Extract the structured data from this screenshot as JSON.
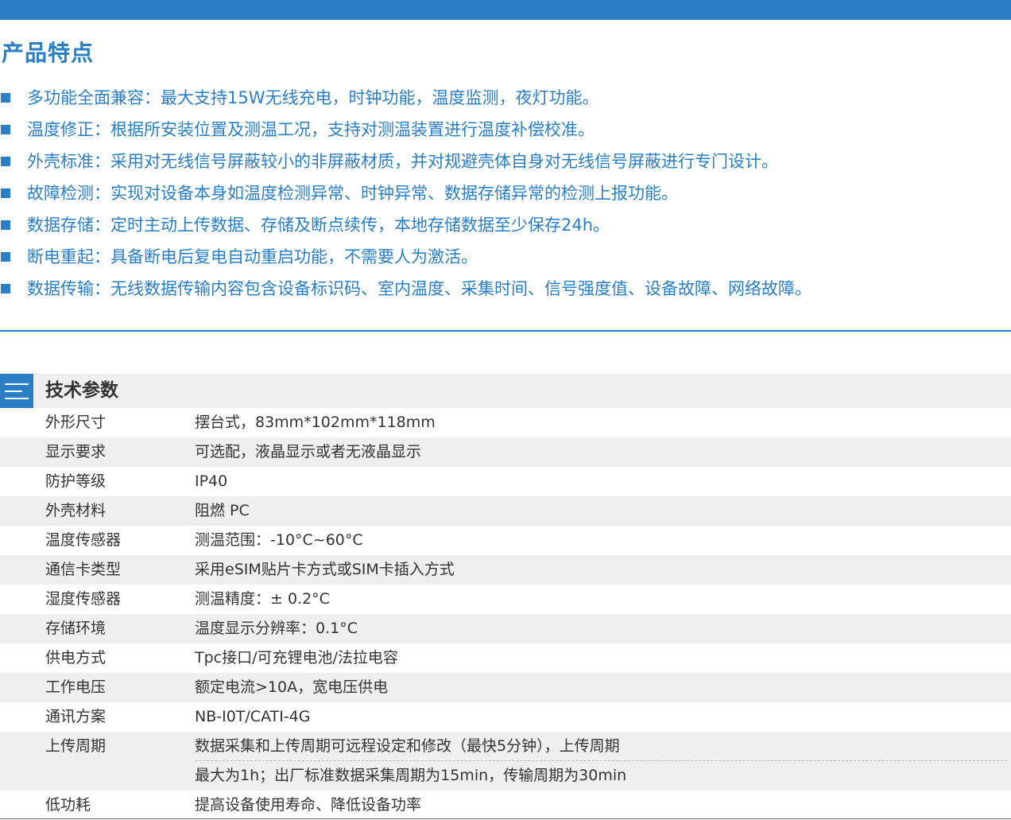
{
  "features": {
    "title": "产品特点",
    "items": [
      "多功能全面兼容：最大支持15W无线充电，时钟功能，温度监测，夜灯功能。",
      "温度修正：根据所安装位置及测温工况，支持对测温装置进行温度补偿校准。",
      "外壳标准：采用对无线信号屏蔽较小的非屏蔽材质，并对规避壳体自身对无线信号屏蔽进行专门设计。",
      "故障检测：实现对设备本身如温度检测异常、时钟异常、数据存储异常的检测上报功能。",
      "数据存储：定时主动上传数据、存储及断点续传，本地存储数据至少保存24h。",
      "断电重起：具备断电后复电自动重启功能，不需要人为激活。",
      "数据传输：无线数据传输内容包含设备标识码、室内温度、采集时间、信号强度值、设备故障、网络故障。"
    ]
  },
  "specs": {
    "title": "技术参数",
    "rows": [
      {
        "label": "外形尺寸",
        "value": "摆台式，83mm*102mm*118mm"
      },
      {
        "label": "显示要求",
        "value": "可选配，液晶显示或者无液晶显示"
      },
      {
        "label": "防护等级",
        "value": "IP40"
      },
      {
        "label": "外壳材料",
        "value": "阻燃 PC"
      },
      {
        "label": "温度传感器",
        "value": "测温范围：-10°C~60°C"
      },
      {
        "label": "通信卡类型",
        "value": "采用eSIM贴片卡方式或SIM卡插入方式"
      },
      {
        "label": "湿度传感器",
        "value": "测温精度：± 0.2°C"
      },
      {
        "label": "存储环境",
        "value": "温度显示分辨率：0.1°C"
      },
      {
        "label": "供电方式",
        "value": "Tpc接口/可充锂电池/法拉电容"
      },
      {
        "label": "工作电压",
        "value": "额定电流>10A，宽电压供电"
      },
      {
        "label": "通讯方案",
        "value": "NB-I0T/CATI-4G"
      },
      {
        "label": "上传周期",
        "value": "数据采集和上传周期可远程设定和修改（最快5分钟），上传周期",
        "value2": "最大为1h；出厂标准数据采集周期为15min，传输周期为30min"
      },
      {
        "label": "低功耗",
        "value": "提高设备使用寿命、降低设备功率"
      }
    ]
  },
  "colors": {
    "accent": "#2a7ec4",
    "row_alt": "#efefef",
    "text": "#333333"
  },
  "icons": {
    "feature_bullet": "square-bullet-icon",
    "spec_header": "list-icon"
  }
}
